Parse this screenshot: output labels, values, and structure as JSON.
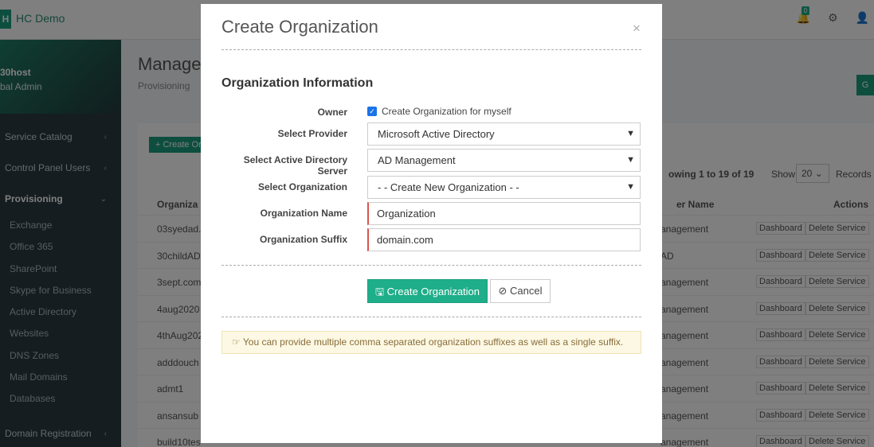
{
  "app": {
    "brand_letter": "H",
    "brand_name": "HC Demo",
    "notif_count": "0"
  },
  "sidebar": {
    "host": "30host",
    "role": "bal Admin",
    "items": [
      {
        "label": "Service Catalog",
        "caret": "‹"
      },
      {
        "label": "Control Panel Users",
        "caret": "‹"
      },
      {
        "label": "Provisioning",
        "caret": "⌄"
      }
    ],
    "sub_items": [
      "Exchange",
      "Office 365",
      "SharePoint",
      "Skype for Business",
      "Active Directory",
      "Websites",
      "DNS Zones",
      "Mail Domains",
      "Databases"
    ],
    "bottom_item": {
      "label": "Domain Registration",
      "caret": "‹"
    }
  },
  "page": {
    "title": "Manage",
    "breadcrumb": "Provisioning",
    "create_button": "+ Create Or",
    "showing": "owing 1 to 19 of 19",
    "show_label": "Show",
    "show_value": "20",
    "records_label": "Records",
    "columns": {
      "name": "Organiza",
      "server": "er Name",
      "actions": "Actions"
    },
    "rows": [
      {
        "name": "03syedad...",
        "server": "anagement",
        "a1": "Dashboard",
        "a2": "Delete Service"
      },
      {
        "name": "30childAD",
        "server": "AD",
        "a1": "Dashboard",
        "a2": "Delete Service"
      },
      {
        "name": "3sept.com",
        "server": "anagement",
        "a1": "Dashboard",
        "a2": "Delete Service"
      },
      {
        "name": "4aug2020",
        "server": "anagement",
        "a1": "Dashboard",
        "a2": "Delete Service"
      },
      {
        "name": "4thAug202",
        "server": "anagement",
        "a1": "Dashboard",
        "a2": "Delete Service"
      },
      {
        "name": "adddouch",
        "server": "anagement",
        "a1": "Dashboard",
        "a2": "Delete Service"
      },
      {
        "name": "admt1",
        "server": "anagement",
        "a1": "Dashboard",
        "a2": "Delete Service"
      },
      {
        "name": "ansansub",
        "server": "anagement",
        "a1": "Dashboard",
        "a2": "Delete Service"
      },
      {
        "name": "build10tes",
        "server": "anagement",
        "a1": "Dashboard",
        "a2": "Delete Service"
      }
    ]
  },
  "modal": {
    "title": "Create Organization",
    "close": "×",
    "section": "Organization Information",
    "owner_label": "Owner",
    "owner_check_label": "Create Organization for myself",
    "provider_label": "Select Provider",
    "provider_value": "Microsoft Active Directory",
    "ad_server_label": "Select Active Directory Server",
    "ad_server_value": "AD Management",
    "org_select_label": "Select Organization",
    "org_select_value": "- - Create New Organization - -",
    "org_name_label": "Organization Name",
    "org_name_placeholder": "Organization",
    "org_suffix_label": "Organization Suffix",
    "org_suffix_placeholder": "domain.com",
    "create_button": "Create Organization",
    "cancel_button": "Cancel",
    "hint": "You can provide multiple comma separated organization suffixes as well as a single suffix."
  },
  "icons": {
    "save": "save-icon",
    "cancel": "ban-icon",
    "hint": "hand-point-icon",
    "check": "check-icon"
  },
  "colors": {
    "accent": "#1fae8a",
    "required": "#d9534f",
    "hint_bg": "#fcf8e3"
  }
}
